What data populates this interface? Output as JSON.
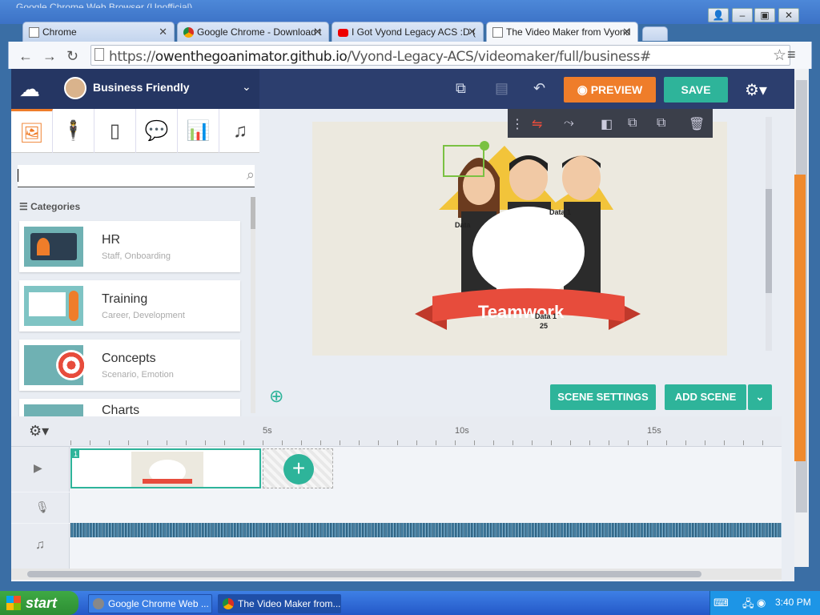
{
  "window": {
    "title": "Google Chrome Web Browser (Unofficial)",
    "minimize_icon": "minimize-icon",
    "maximize_icon": "maximize-icon",
    "close_icon": "close-icon"
  },
  "tabs": [
    {
      "label": "Chrome",
      "icon": "document-icon",
      "active": false
    },
    {
      "label": "Google Chrome - Download t",
      "icon": "chrome-icon",
      "active": false
    },
    {
      "label": "I Got Vyond Legacy ACS :D (",
      "icon": "youtube-icon",
      "active": false
    },
    {
      "label": "The Video Maker from Vyond",
      "icon": "document-icon",
      "active": true
    }
  ],
  "toolbar": {
    "url_scheme": "https://",
    "url_host": "owenthegoanimator.github.io",
    "url_path": "/Vyond-Legacy-ACS/videomaker/full/business#"
  },
  "app": {
    "theme_name": "Business Friendly",
    "preview_label": "PREVIEW",
    "save_label": "SAVE",
    "search_placeholder": "",
    "categories_label": "Categories",
    "categories": [
      {
        "title": "HR",
        "subtitle": "Staff, Onboarding"
      },
      {
        "title": "Training",
        "subtitle": "Career, Development"
      },
      {
        "title": "Concepts",
        "subtitle": "Scenario, Emotion"
      },
      {
        "title": "Charts",
        "subtitle": ""
      }
    ],
    "stage": {
      "banner_text": "Teamwork",
      "data_label_1": "Data 1",
      "data_label_2": "Data",
      "data_label_3": "Data 1",
      "data_value": "25"
    },
    "scene_settings_label": "SCENE SETTINGS",
    "add_scene_label": "ADD SCENE",
    "timeline": {
      "ticks": [
        "5s",
        "10s",
        "15s"
      ],
      "scene_number": "1"
    }
  },
  "taskbar": {
    "start_label": "start",
    "tasks": [
      {
        "label": "Google Chrome Web ...",
        "active": false
      },
      {
        "label": "The Video Maker from...",
        "active": true
      }
    ],
    "clock": "3:40 PM"
  }
}
